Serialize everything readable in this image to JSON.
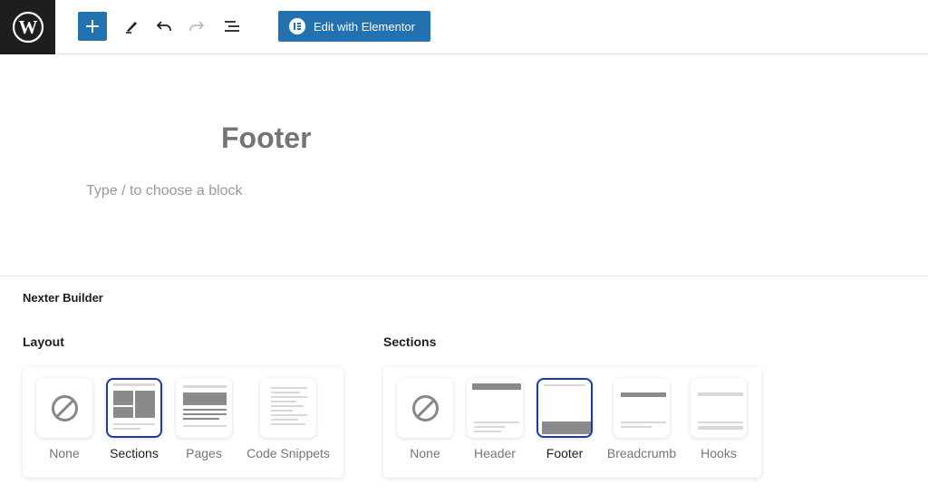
{
  "toolbar": {
    "elementor_label": "Edit with Elementor",
    "icons": [
      "wordpress-icon",
      "plus-icon",
      "pencil-icon",
      "undo-icon",
      "redo-icon",
      "list-view-icon"
    ]
  },
  "editor": {
    "title": "Footer",
    "block_placeholder": "Type / to choose a block"
  },
  "builder": {
    "title": "Nexter Builder",
    "layout": {
      "label": "Layout",
      "options": [
        "None",
        "Sections",
        "Pages",
        "Code Snippets"
      ],
      "selected": "Sections"
    },
    "sections": {
      "label": "Sections",
      "options": [
        "None",
        "Header",
        "Footer",
        "Breadcrumb",
        "Hooks"
      ],
      "selected": "Footer"
    }
  },
  "colors": {
    "accent": "#2271b1",
    "selected_border": "#1d3aa8",
    "topbar_logo_bg": "#1e1e1e"
  }
}
